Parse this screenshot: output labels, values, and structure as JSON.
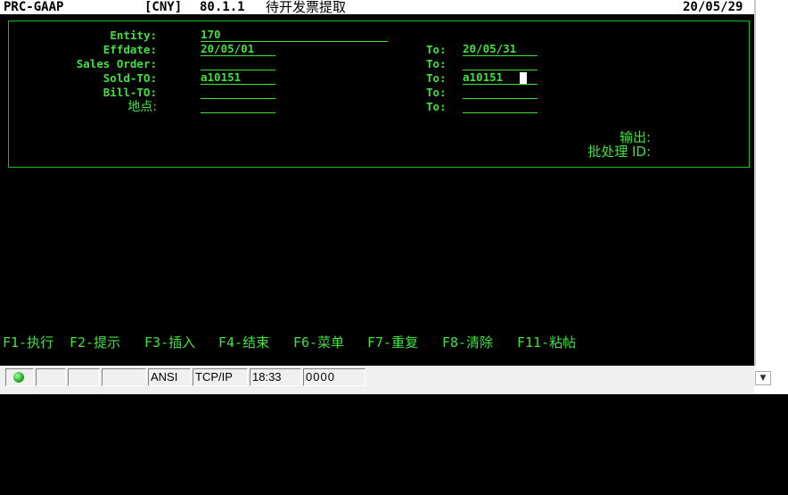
{
  "header": {
    "system": "PRC-GAAP",
    "currency": "[CNY]",
    "menu_code": "80.1.1",
    "title": "待开发票提取",
    "date": "20/05/29"
  },
  "form": {
    "entity_label": "Entity:",
    "entity_value": "170",
    "effdate_label": "Effdate:",
    "effdate_from": "20/05/01",
    "effdate_to": "20/05/31",
    "sales_order_label": "Sales Order:",
    "sales_order_from": "",
    "sales_order_to": "",
    "sold_to_label": "Sold-TO:",
    "sold_to_from": "a10151",
    "sold_to_to": "a10151",
    "bill_to_label": "Bill-TO:",
    "bill_to_from": "",
    "bill_to_to": "",
    "site_label": "地点:",
    "site_from": "",
    "site_to": "",
    "to_label": "To:",
    "output_label": "输出:",
    "batch_label": "批处理 ID:"
  },
  "function_keys": [
    "F1-执行",
    "F2-提示",
    "F3-插入",
    "F4-结束",
    "F6-菜单",
    "F7-重复",
    "F8-清除",
    "F11-粘帖"
  ],
  "status_bar": {
    "encoding": "ANSI",
    "protocol": "TCP/IP",
    "time": "18:33",
    "counter": "0000",
    "connection_color": "#1a9a1a"
  }
}
